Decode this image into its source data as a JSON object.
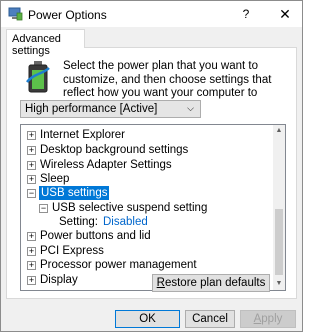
{
  "window": {
    "title": "Power Options",
    "help_glyph": "?",
    "close_glyph": "✕",
    "app_icon": "power-options-icon"
  },
  "tabs": [
    {
      "label": "Advanced settings",
      "selected": true
    }
  ],
  "description": "Select the power plan that you want to customize, and then choose settings that reflect how you want your computer to manage power.",
  "plan_select": {
    "value": "High performance [Active]",
    "chevron": "⌵"
  },
  "tree": {
    "items": [
      {
        "label": "Internet Explorer",
        "expander": "+",
        "level": 0
      },
      {
        "label": "Desktop background settings",
        "expander": "+",
        "level": 0
      },
      {
        "label": "Wireless Adapter Settings",
        "expander": "+",
        "level": 0
      },
      {
        "label": "Sleep",
        "expander": "+",
        "level": 0
      },
      {
        "label": "USB settings",
        "expander": "−",
        "level": 0,
        "selected": true
      },
      {
        "label": "USB selective suspend setting",
        "expander": "−",
        "level": 1
      },
      {
        "label": "Setting:",
        "value": "Disabled",
        "level": 2
      },
      {
        "label": "Power buttons and lid",
        "expander": "+",
        "level": 0
      },
      {
        "label": "PCI Express",
        "expander": "+",
        "level": 0
      },
      {
        "label": "Processor power management",
        "expander": "+",
        "level": 0
      },
      {
        "label": "Display",
        "expander": "+",
        "level": 0
      }
    ],
    "scroll_up": "▲",
    "scroll_down": "▼"
  },
  "buttons": {
    "restore_prefix": "",
    "restore_ul": "R",
    "restore_rest": "estore plan defaults",
    "ok": "OK",
    "cancel": "Cancel",
    "apply_ul": "A",
    "apply_rest": "pply"
  },
  "colors": {
    "selection": "#0078d7",
    "link_value": "#0066cc"
  }
}
